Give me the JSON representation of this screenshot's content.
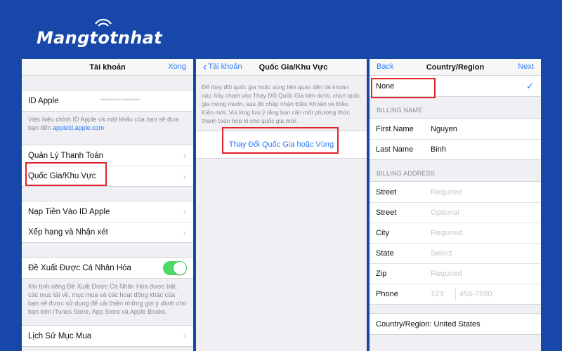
{
  "logo": {
    "prefix": "Mangt",
    "o": "o",
    "suffix": "tnhat"
  },
  "panel1": {
    "title": "Tài khoản",
    "done": "Xong",
    "apple_id_label": "ID Apple",
    "apple_id_value": "••••••••••••••••••",
    "apple_id_note": "Việc hiệu chỉnh ID Apple và mật khẩu của bạn sẽ đưa bạn đến ",
    "apple_id_link": "appleid.apple.com",
    "items_a": [
      "Quản Lý Thanh Toán",
      "Quốc Gia/Khu Vực"
    ],
    "items_b": [
      "Nạp Tiền Vào ID Apple",
      "Xếp hạng và Nhận xét"
    ],
    "personalize_label": "Đề Xuất Được Cá Nhân Hóa",
    "personalize_on": true,
    "personalize_note": "Khi tính năng Đề Xuất Được Cá Nhân Hóa được bật, các mục tải về, mục mua và các hoạt động khác của bạn sẽ được sử dụng để cải thiện những gợi ý dành cho bạn trên iTunes Store, App Store và Apple Books.",
    "history": "Lịch Sử Mục Mua"
  },
  "panel2": {
    "back": "Tài khoản",
    "title": "Quốc Gia/Khu Vực",
    "description": "Để thay đổi quốc gia hoặc vùng liên quan đến tài khoản này, hãy chạm vào Thay Đổi Quốc Gia bên dưới, chọn quốc gia mong muốn, sau đó chấp nhận Điều Khoản và Điều Kiện mới. Vui lòng lưu ý rằng bạn cần một phương thức thanh toán hợp lệ cho quốc gia mới.",
    "change_button": "Thay Đổi Quốc Gia hoặc Vùng"
  },
  "panel3": {
    "back": "Back",
    "title": "Country/Region",
    "next": "Next",
    "payment_selected": "None",
    "billing_name_header": "BILLING NAME",
    "first_name_label": "First Name",
    "first_name_value": "Nguyen",
    "last_name_label": "Last Name",
    "last_name_value": "Binh",
    "billing_address_header": "BILLING ADDRESS",
    "street1_label": "Street",
    "street1_placeholder": "Required",
    "street2_label": "Street",
    "street2_placeholder": "Optional",
    "city_label": "City",
    "city_placeholder": "Required",
    "state_label": "State",
    "state_placeholder": "Select",
    "zip_label": "Zip",
    "zip_placeholder": "Required",
    "phone_label": "Phone",
    "phone_area_placeholder": "123",
    "phone_number_placeholder": "456-7890",
    "country_footer": "Country/Region: United States"
  },
  "colors": {
    "background": "#1747a8",
    "ios_blue": "#2f7cf6",
    "highlight_red": "#e1232b",
    "toggle_green": "#4cd964"
  }
}
